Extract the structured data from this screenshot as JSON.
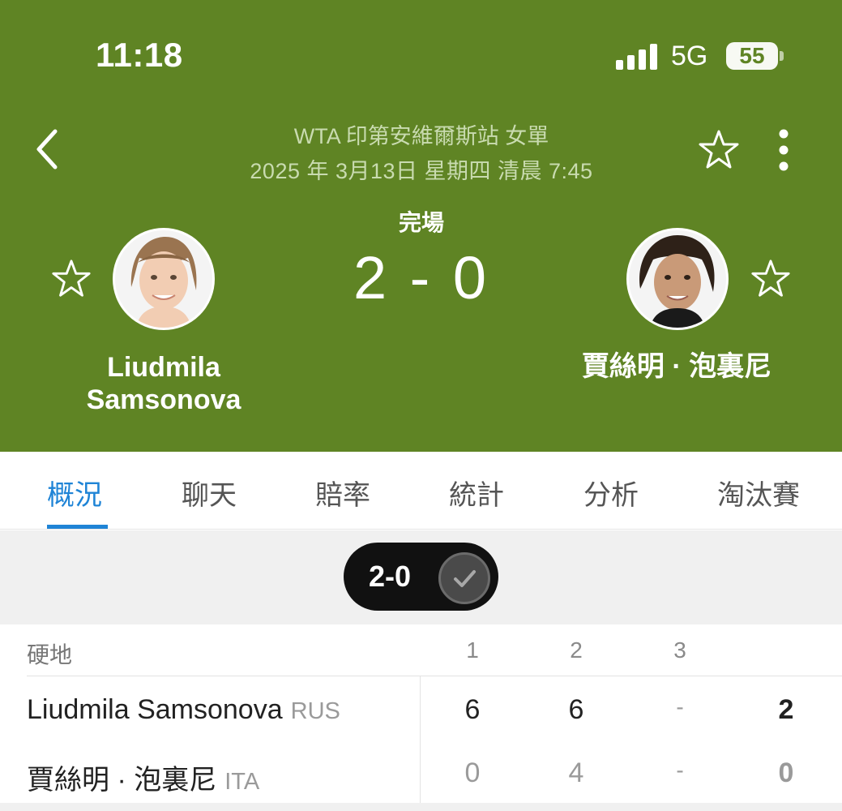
{
  "status_bar": {
    "time": "11:18",
    "network": "5G",
    "battery": "55"
  },
  "header": {
    "league": "WTA 印第安維爾斯站 女單",
    "date": "2025 年 3月13日 星期四 清晨 7:45",
    "match_status": "完場",
    "score": "2 - 0"
  },
  "players": {
    "home": {
      "name_line1": "Liudmila",
      "name_line2": "Samsonova"
    },
    "away": {
      "name": "賈絲明 · 泡裏尼"
    }
  },
  "tabs": [
    "概況",
    "聊天",
    "賠率",
    "統計",
    "分析",
    "淘汰賽"
  ],
  "active_tab": "概況",
  "summary": {
    "score": "2-0"
  },
  "scoreboard": {
    "surface": "硬地",
    "set_headers": [
      "1",
      "2",
      "3"
    ],
    "rows": [
      {
        "name": "Liudmila Samsonova",
        "country": "RUS",
        "sets": [
          "6",
          "6",
          "-"
        ],
        "total": "2"
      },
      {
        "name": "賈絲明 · 泡裏尼",
        "country": "ITA",
        "sets": [
          "0",
          "4",
          "-"
        ],
        "total": "0"
      }
    ]
  },
  "colors": {
    "header_green": "#5f8424",
    "accent_blue": "#1f84d6",
    "winner_text": "#222222",
    "loser_text": "#9a9a9a"
  }
}
